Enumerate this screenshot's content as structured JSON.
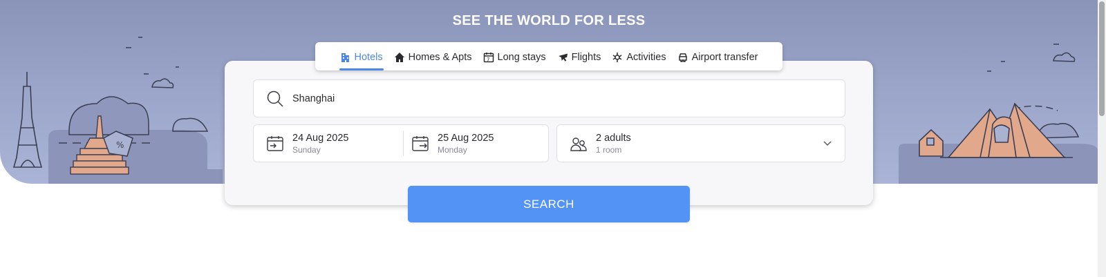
{
  "hero": {
    "title": "SEE THE WORLD FOR LESS"
  },
  "tabs": [
    {
      "label": "Hotels",
      "icon": "hotel-icon",
      "active": true
    },
    {
      "label": "Homes & Apts",
      "icon": "home-icon",
      "active": false
    },
    {
      "label": "Long stays",
      "icon": "calendar-7-icon",
      "active": false
    },
    {
      "label": "Flights",
      "icon": "plane-icon",
      "active": false
    },
    {
      "label": "Activities",
      "icon": "activities-icon",
      "active": false
    },
    {
      "label": "Airport transfer",
      "icon": "car-icon",
      "active": false
    }
  ],
  "search": {
    "value": "Shanghai",
    "icon": "search-icon"
  },
  "checkin": {
    "date": "24 Aug 2025",
    "day": "Sunday",
    "icon": "calendar-checkin-icon"
  },
  "checkout": {
    "date": "25 Aug 2025",
    "day": "Monday",
    "icon": "calendar-checkout-icon"
  },
  "guests": {
    "adults": "2 adults",
    "rooms": "1 room",
    "icon": "guests-icon"
  },
  "search_button": {
    "label": "SEARCH"
  },
  "colors": {
    "accent": "#4b86e8",
    "button": "#5393f5",
    "hero_top": "#8a94b8",
    "hero_bottom": "#aab4d6",
    "illustration": "#e2a88c"
  }
}
